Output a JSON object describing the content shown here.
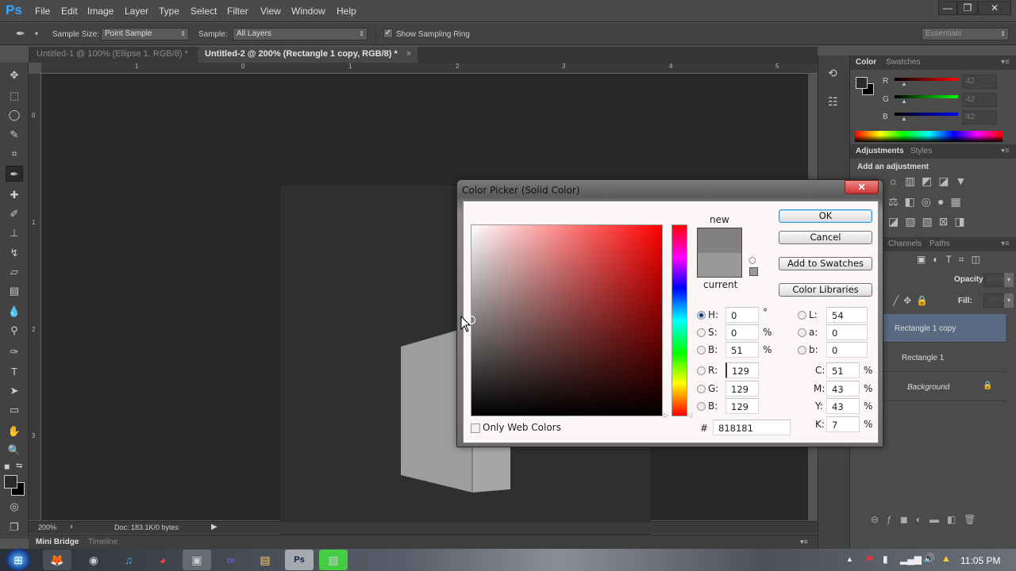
{
  "app": {
    "logo": "Ps"
  },
  "menu": [
    "File",
    "Edit",
    "Image",
    "Layer",
    "Type",
    "Select",
    "Filter",
    "View",
    "Window",
    "Help"
  ],
  "window_controls": {
    "minimize": "—",
    "restore": "❐",
    "close": "✕"
  },
  "options_bar": {
    "tool_icon": "eyedropper-icon",
    "sample_size_label": "Sample Size:",
    "sample_size_value": "Point Sample",
    "sample_label": "Sample:",
    "sample_value": "All Layers",
    "show_ring_label": "Show Sampling Ring",
    "show_ring_checked": true,
    "workspace": "Essentials"
  },
  "tabs": [
    {
      "label": "Untitled-1 @ 100% (Ellipse 1, RGB/8) *",
      "active": false
    },
    {
      "label": "Untitled-2 @ 200% (Rectangle 1 copy, RGB/8) *",
      "active": true
    }
  ],
  "ruler": {
    "top": [
      "1",
      "0",
      "1",
      "2",
      "3",
      "4",
      "5"
    ],
    "left": [
      "0",
      "1",
      "2",
      "3"
    ]
  },
  "status": {
    "zoom": "200%",
    "doc": "Doc: 183.1K/0 bytes"
  },
  "bottom_tabs": [
    "Mini Bridge",
    "Timeline"
  ],
  "color_panel": {
    "tabs": [
      "Color",
      "Swatches"
    ],
    "channels": [
      {
        "label": "R",
        "value": "42"
      },
      {
        "label": "G",
        "value": "42"
      },
      {
        "label": "B",
        "value": "42"
      }
    ],
    "fg": "#2a2a2a",
    "bg": "#000000"
  },
  "adjustments_panel": {
    "tabs": [
      "Adjustments",
      "Styles"
    ],
    "heading": "Add an adjustment"
  },
  "layers_panel": {
    "tabs": [
      "Channels",
      "Paths"
    ],
    "opacity_label": "Opacity:",
    "opacity_value": "100%",
    "fill_label": "Fill:",
    "fill_value": "100%",
    "layers": [
      {
        "name": "Rectangle 1 copy",
        "selected": true
      },
      {
        "name": "Rectangle 1",
        "selected": false
      },
      {
        "name": "Background",
        "selected": false,
        "locked": true
      }
    ]
  },
  "color_picker": {
    "title": "Color Picker (Solid Color)",
    "close": "✕",
    "new_label": "new",
    "current_label": "current",
    "new_color": "#818181",
    "current_color": "#999999",
    "buttons": {
      "ok": "OK",
      "cancel": "Cancel",
      "add_swatches": "Add to Swatches",
      "libraries": "Color Libraries"
    },
    "hsb": [
      {
        "label": "H:",
        "value": "0",
        "unit": "°",
        "checked": true
      },
      {
        "label": "S:",
        "value": "0",
        "unit": "%",
        "checked": false
      },
      {
        "label": "B:",
        "value": "51",
        "unit": "%",
        "checked": false
      }
    ],
    "rgb": [
      {
        "label": "R:",
        "value": "129"
      },
      {
        "label": "G:",
        "value": "129"
      },
      {
        "label": "B:",
        "value": "129"
      }
    ],
    "lab": [
      {
        "label": "L:",
        "value": "54"
      },
      {
        "label": "a:",
        "value": "0"
      },
      {
        "label": "b:",
        "value": "0"
      }
    ],
    "cmyk": [
      {
        "label": "C:",
        "value": "51",
        "unit": "%"
      },
      {
        "label": "M:",
        "value": "43",
        "unit": "%"
      },
      {
        "label": "Y:",
        "value": "43",
        "unit": "%"
      },
      {
        "label": "K:",
        "value": "7",
        "unit": "%"
      }
    ],
    "hex_label": "#",
    "hex": "818181",
    "web_colors_label": "Only Web Colors",
    "web_colors_checked": false
  },
  "taskbar": {
    "clock": "11:05 PM"
  }
}
